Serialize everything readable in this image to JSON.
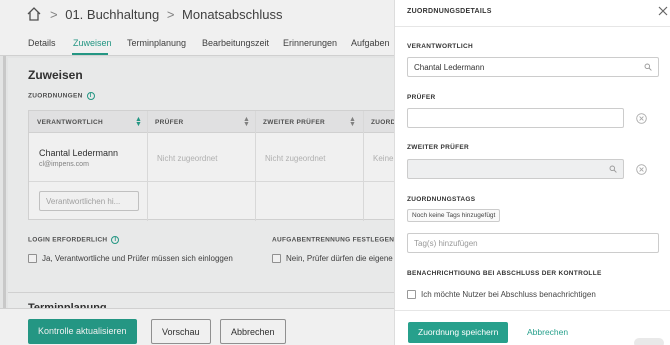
{
  "breadcrumb": {
    "folder": "01. Buchhaltung",
    "page": "Monatsabschluss",
    "separator": ">"
  },
  "tabs": [
    {
      "label": "Details",
      "active": false
    },
    {
      "label": "Zuweisen",
      "active": true
    },
    {
      "label": "Terminplanung",
      "active": false
    },
    {
      "label": "Bearbeitungszeit",
      "active": false
    },
    {
      "label": "Erinnerungen",
      "active": false
    },
    {
      "label": "Aufgaben",
      "active": false
    }
  ],
  "section": {
    "title": "Zuweisen",
    "assignments_label": "ZUORDNUNGEN"
  },
  "table": {
    "headers": [
      "VERANTWORTLICH",
      "PRÜFER",
      "ZWEITER PRÜFER",
      "ZUORD"
    ],
    "row": {
      "name": "Chantal Ledermann",
      "email": "cl@impens.com",
      "reviewer": "Nicht zugeordnet",
      "second_reviewer": "Nicht zugeordnet",
      "tags": "Keine"
    },
    "new_responsible_placeholder": "Verantwortlichen hi..."
  },
  "login": {
    "label": "LOGIN ERFORDERLICH",
    "checkbox": "Ja, Verantwortliche und Prüfer müssen sich einloggen"
  },
  "separation": {
    "label": "AUFGABENTRENNUNG FESTLEGEN",
    "checkbox": "Nein, Prüfer dürfen die eigene"
  },
  "next_section": "Terminplanung",
  "footer": {
    "update": "Kontrolle aktualisieren",
    "preview": "Vorschau",
    "cancel": "Abbrechen"
  },
  "drawer": {
    "title": "ZUORDNUNGSDETAILS",
    "responsible_label": "VERANTWORTLICH",
    "responsible_value": "Chantal Ledermann",
    "reviewer_label": "PRÜFER",
    "reviewer_value": "",
    "second_reviewer_label": "ZWEITER PRÜFER",
    "second_reviewer_value": "",
    "tags_label": "ZUORDNUNGSTAGS",
    "no_tags": "Noch keine Tags hinzugefügt",
    "tags_placeholder": "Tag(s) hinzufügen",
    "notify_label": "BENACHRICHTIGUNG BEI ABSCHLUSS DER KONTROLLE",
    "notify_checkbox": "Ich möchte Nutzer bei Abschluss benachrichtigen",
    "save": "Zuordnung speichern",
    "cancel": "Abbrechen"
  },
  "colors": {
    "accent": "#27a08c"
  }
}
